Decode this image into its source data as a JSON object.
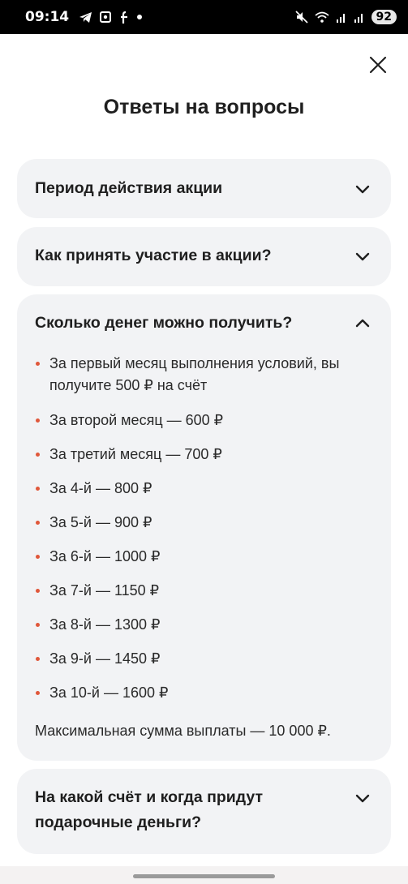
{
  "status_bar": {
    "time": "09:14",
    "left_icons": [
      "telegram-icon",
      "screenshot-icon",
      "fb-icon",
      "dot-icon"
    ],
    "right_icons": [
      "mute-icon",
      "wifi-icon",
      "signal-icon",
      "signal-icon"
    ],
    "battery": "92"
  },
  "modal": {
    "title": "Ответы на вопросы",
    "close_icon": "close-icon"
  },
  "faq": [
    {
      "question": "Период действия акции",
      "expanded": false
    },
    {
      "question": "Как принять участие в акции?",
      "expanded": false
    },
    {
      "question": "Сколько денег можно получить?",
      "expanded": true,
      "items": [
        "За первый месяц выполнения условий, вы получите 500 ₽ на счёт",
        "За второй месяц — 600 ₽",
        "За третий месяц — 700 ₽",
        "За 4-й — 800 ₽",
        "За 5-й — 900 ₽",
        "За 6-й — 1000 ₽",
        "За 7-й — 1150 ₽",
        "За 8-й — 1300 ₽",
        "За 9-й — 1450 ₽",
        "За 10-й — 1600 ₽"
      ],
      "footer": "Максимальная сумма выплаты — 10 000 ₽."
    },
    {
      "question": "На какой счёт и когда придут подарочные деньги?",
      "expanded": false
    }
  ],
  "colors": {
    "bullet": "#e0573a",
    "card_bg": "#f2f3f5",
    "text": "#1f1f1f"
  }
}
